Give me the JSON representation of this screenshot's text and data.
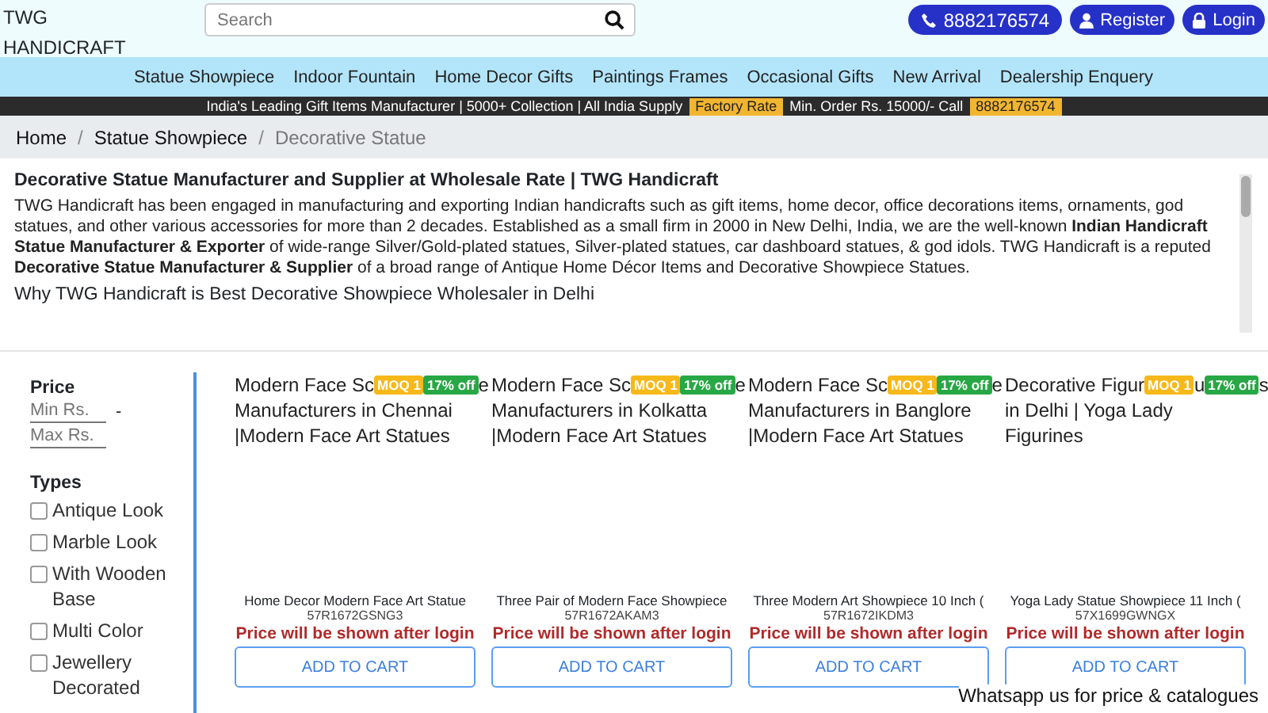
{
  "header": {
    "logo": "TWG HANDICRAFT",
    "search": {
      "placeholder": "Search"
    },
    "phone": "8882176574",
    "buttons": [
      "Register",
      "Login"
    ]
  },
  "nav": [
    "Statue Showpiece",
    "Indoor Fountain",
    "Home Decor Gifts",
    "Paintings Frames",
    "Occasional Gifts",
    "New Arrival",
    "Dealership Enquery"
  ],
  "banner": {
    "text": "India's Leading Gift Items Manufacturer | 5000+ Collection | All India Supply",
    "badge": "Factory Rate",
    "order": "Min. Order Rs. 15000/- Call",
    "phone": "8882176574"
  },
  "breadcrumb_separator": "/",
  "breadcrumb": [
    {
      "label": "Home",
      "current": false
    },
    {
      "label": "Statue Showpiece",
      "current": false
    },
    {
      "label": "Decorative Statue",
      "current": true
    }
  ],
  "description": {
    "title": "Decorative Statue Manufacturer and Supplier at Wholesale Rate | TWG Handicraft",
    "paragraph": "TWG Handicraft has been engaged in manufacturing and exporting Indian handicrafts such as gift items, home decor, office decorations items, ornaments, god statues, and other various accessories for more than 2 decades. Established as a small firm in 2000 in New Delhi, India, we are the well-known **Indian Handicraft Statue Manufacturer & Exporter** of wide-range Silver/Gold-plated statues, Silver-plated statues, car dashboard statues, & god idols. TWG Handicraft is a reputed **Decorative Statue Manufacturer & Supplier** of a broad range of Antique Home Décor Items and Decorative Showpiece Statues.",
    "subtitle": "Why TWG Handicraft is Best Decorative Showpiece Wholesaler in Delhi"
  },
  "filters": {
    "price_title": "Price",
    "min": {
      "placeholder": "Min Rs."
    },
    "separator": "-",
    "max": {
      "placeholder": "Max Rs."
    },
    "types_title": "Types",
    "types": [
      {
        "label": "Antique Look",
        "checked": false
      },
      {
        "label": "Marble Look",
        "checked": false
      },
      {
        "label": "With Wooden Base",
        "checked": false
      },
      {
        "label": "Multi Color",
        "checked": false
      },
      {
        "label": "Jewellery Decorated",
        "checked": false
      }
    ]
  },
  "products": [
    {
      "title_parts": [
        {
          "kind": "text",
          "text": "Modern Face Sc"
        },
        {
          "kind": "moq",
          "text": "MOQ 1"
        },
        {
          "kind": "discount",
          "text": "17% off"
        },
        {
          "kind": "text",
          "text": "e"
        }
      ],
      "title_rest": "Manufacturers in Chennai |Modern Face Art Statues",
      "name": "Home Decor Modern Face Art Statue",
      "code": "57R1672GSNG3",
      "price": "Price will be shown after login",
      "button": "ADD TO CART"
    },
    {
      "title_parts": [
        {
          "kind": "text",
          "text": "Modern Face Sc"
        },
        {
          "kind": "moq",
          "text": "MOQ 1"
        },
        {
          "kind": "discount",
          "text": "17% off"
        },
        {
          "kind": "text",
          "text": "e"
        }
      ],
      "title_rest": "Manufacturers in Kolkatta |Modern Face Art Statues",
      "name": "Three Pair of Modern Face Showpiece",
      "code": "57R1672AKAM3",
      "price": "Price will be shown after login",
      "button": "ADD TO CART"
    },
    {
      "title_parts": [
        {
          "kind": "text",
          "text": "Modern Face Sc"
        },
        {
          "kind": "moq",
          "text": "MOQ 1"
        },
        {
          "kind": "discount",
          "text": "17% off"
        },
        {
          "kind": "text",
          "text": "e"
        }
      ],
      "title_rest": "Manufacturers in Banglore |Modern Face Art Statues",
      "name": "Three Modern Art Showpiece 10 Inch (",
      "code": "57R1672IKDM3",
      "price": "Price will be shown after login",
      "button": "ADD TO CART"
    },
    {
      "title_parts": [
        {
          "kind": "text",
          "text": "Decorative Figur"
        },
        {
          "kind": "moq",
          "text": "MOQ 1"
        },
        {
          "kind": "text",
          "text": "u"
        },
        {
          "kind": "discount",
          "text": "17% off"
        },
        {
          "kind": "text",
          "text": "s"
        }
      ],
      "title_rest": "in Delhi | Yoga Lady Figurines",
      "name": "Yoga Lady Statue Showpiece 11 Inch (",
      "code": "57X1699GWNGX",
      "price": "Price will be shown after login",
      "button": "ADD TO CART"
    }
  ],
  "whatsapp": "Whatsapp us for price & catalogues"
}
